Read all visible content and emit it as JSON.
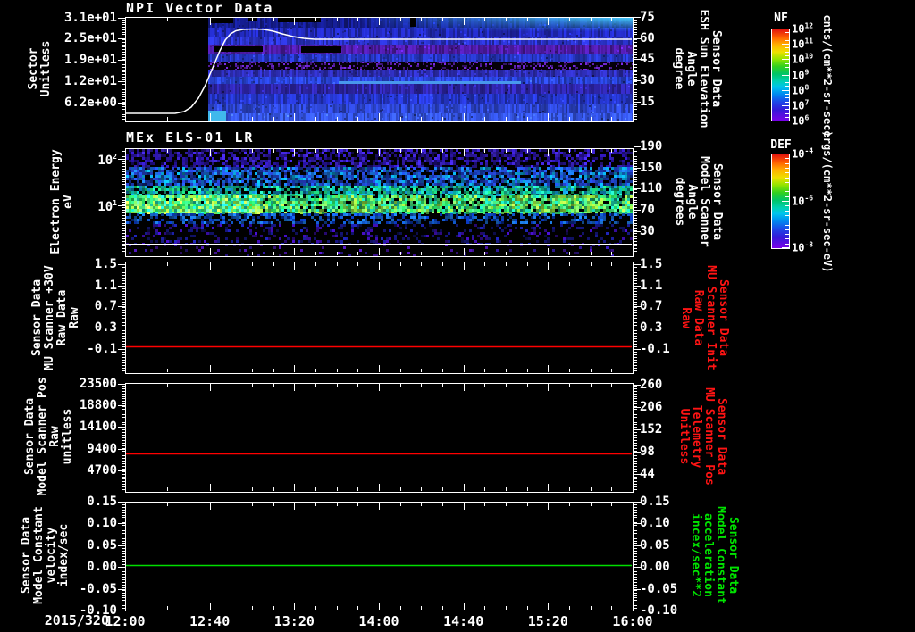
{
  "page": {
    "background": "#000000",
    "foreground": "#ffffff"
  },
  "x_axis": {
    "date_label": "2015/320",
    "tick_labels": [
      "12:00",
      "12:40",
      "13:20",
      "14:00",
      "14:40",
      "15:20",
      "16:00"
    ]
  },
  "panels": [
    {
      "id": "npi",
      "title": "NPI Vector Data",
      "left_label_lines": [
        "Sector",
        "Unitless"
      ],
      "left_ticks": [
        "3.1e+01",
        "2.5e+01",
        "1.9e+01",
        "1.2e+01",
        "6.2e+00"
      ],
      "right_label_lines": [
        "Sensor Data",
        "ESH Sun Elevation",
        "Angle",
        "degree"
      ],
      "right_ticks": [
        "75",
        "60",
        "45",
        "30",
        "15"
      ],
      "right_label_color": "#ffffff"
    },
    {
      "id": "els",
      "title": "MEx ELS-01 LR",
      "left_label_lines": [
        "Electron Energy",
        "eV"
      ],
      "left_ticks": [
        "10^2",
        "10^1"
      ],
      "right_label_lines": [
        "Sensor Data",
        "Model Scanner",
        "Angle",
        "degrees"
      ],
      "right_ticks": [
        "190",
        "150",
        "110",
        "70",
        "30"
      ],
      "right_label_color": "#ffffff"
    },
    {
      "id": "mu-scanner-30v",
      "title": "",
      "left_label_lines": [
        "Sensor Data",
        "MU Scanner +30V",
        "Raw Data",
        "Raw"
      ],
      "left_ticks": [
        "1.5",
        "1.1",
        "0.7",
        "0.3",
        "-0.1"
      ],
      "right_label_lines": [
        "Sensor Data",
        "MU Scanner Init",
        "Raw Data",
        "Raw"
      ],
      "right_ticks": [
        "1.5",
        "1.1",
        "0.7",
        "0.3",
        "-0.1"
      ],
      "right_label_color": "#ff1414",
      "line": {
        "color": "#ff0000",
        "value": 0.0
      }
    },
    {
      "id": "model-scanner-pos",
      "title": "",
      "left_label_lines": [
        "Sensor Data",
        "Model Scanner Pos",
        "Raw",
        "unitless"
      ],
      "left_ticks": [
        "23500",
        "18800",
        "14100",
        "9400",
        "4700"
      ],
      "right_label_lines": [
        "Sensor Data",
        "MU Scanner Pos",
        "Telemetry",
        "Unitless"
      ],
      "right_ticks": [
        "260",
        "206",
        "152",
        "98",
        "44"
      ],
      "right_label_color": "#ff1414",
      "line": {
        "color": "#ff0000",
        "value": 8100
      }
    },
    {
      "id": "model-constant-velocity",
      "title": "",
      "left_label_lines": [
        "Sensor Data",
        "Model Constant",
        "velocity",
        "index/sec"
      ],
      "left_ticks": [
        "0.15",
        "0.10",
        "0.05",
        "0.00",
        "-0.05",
        "-0.10"
      ],
      "right_label_lines": [
        "Sensor Data",
        "Model Constant",
        "acceleration",
        "incex/sec**2"
      ],
      "right_ticks": [
        "0.15",
        "0.10",
        "0.05",
        "0.00",
        "-0.05",
        "-0.10"
      ],
      "right_label_color": "#00e400",
      "line": {
        "color": "#00dd00",
        "value": 0.0
      }
    }
  ],
  "colorbars": [
    {
      "title": "NF",
      "tick_labels": [
        "10^12",
        "10^11",
        "10^10",
        "10^9",
        "10^8",
        "10^7",
        "10^6"
      ],
      "units": "cnts/(cm**2-sr-sec)"
    },
    {
      "title": "DEF",
      "tick_labels": [
        "10^-4",
        "10^-6",
        "10^-8"
      ],
      "units": "ergs/(cm**2-sr-sec-eV)"
    }
  ],
  "chart_data": [
    {
      "type": "heatmap",
      "id": "npi",
      "title": "NPI Vector Data",
      "x_range": [
        "12:00",
        "16:00"
      ],
      "data_gap_until": "12:39",
      "ylabel": "Sector Unitless",
      "y_ticks": [
        31,
        25,
        19,
        12,
        6.2
      ],
      "z_units": "cnts/(cm**2-sr-sec)",
      "z_range_log10": [
        6,
        12
      ],
      "bands": [
        {
          "y0": 0.0,
          "y1": 0.095,
          "color": "#141c8c",
          "var": 0.5
        },
        {
          "y0": 0.095,
          "y1": 0.19,
          "color": "#2028b4",
          "var": 0.4
        },
        {
          "y0": 0.19,
          "y1": 0.26,
          "color": "#2830c0",
          "var": 0.4
        },
        {
          "y0": 0.26,
          "y1": 0.345,
          "color": "#4a1aa0",
          "var": 0.5
        },
        {
          "y0": 0.345,
          "y1": 0.42,
          "color": "#2534bc",
          "var": 0.4
        },
        {
          "y0": 0.42,
          "y1": 0.5,
          "color": "#050008",
          "var": 0.3,
          "speckle": {
            "color": "#5a1ea8",
            "density": 0.3
          }
        },
        {
          "y0": 0.5,
          "y1": 0.565,
          "color": "#2c2cb0",
          "var": 0.5
        },
        {
          "y0": 0.565,
          "y1": 0.64,
          "color": "#2842d4",
          "var": 0.45
        },
        {
          "y0": 0.64,
          "y1": 0.73,
          "color": "#2c24a4",
          "var": 0.45
        },
        {
          "y0": 0.73,
          "y1": 0.83,
          "color": "#2434c4",
          "var": 0.4
        },
        {
          "y0": 0.83,
          "y1": 0.92,
          "color": "#2c44cc",
          "var": 0.4
        },
        {
          "y0": 0.92,
          "y1": 1.0,
          "color": "#3352e0",
          "var": 0.45
        }
      ],
      "features": {
        "start_frac": 0.162,
        "cyan_glow": {
          "color": "#46cdff",
          "x_frac": 0.45,
          "depth_frac": 0.13
        },
        "black_blobs": [
          [
            0.165,
            0.0,
            0.045,
            0.05
          ],
          [
            0.24,
            0.0,
            0.02,
            0.035
          ],
          [
            0.3,
            0.0,
            0.085,
            0.04
          ],
          [
            0.175,
            0.27,
            0.095,
            0.06
          ],
          [
            0.345,
            0.265,
            0.08,
            0.07
          ],
          [
            0.56,
            0.0,
            0.012,
            0.09
          ]
        ],
        "cyan_patch": [
          0.162,
          0.9,
          0.035,
          0.1
        ],
        "streak": {
          "y": 0.615,
          "x0": 0.42,
          "x1": 0.78,
          "color": "#4898ec"
        }
      },
      "overlay_line": {
        "name": "Sensor Data ESH Sun Elevation Angle",
        "units": "degree",
        "color": "#ffffff",
        "points_time_deg": [
          [
            "12:00",
            7.5
          ],
          [
            "12:24",
            7.5
          ],
          [
            "12:40",
            48
          ],
          [
            "12:48",
            64
          ],
          [
            "12:56",
            66
          ],
          [
            "13:05",
            65
          ],
          [
            "13:20",
            61
          ],
          [
            "13:30",
            60
          ],
          [
            "16:00",
            60
          ]
        ]
      }
    },
    {
      "type": "heatmap",
      "id": "els",
      "title": "MEx ELS-01 LR",
      "x_range": [
        "12:00",
        "16:00"
      ],
      "ylabel": "Electron Energy eV",
      "y_scale": "log",
      "y_ticks": [
        100,
        10
      ],
      "z_units": "ergs/(cm**2-sr-sec-eV)",
      "z_range_log10": [
        -8,
        -4
      ],
      "peak_band_energy_eV": [
        8,
        25
      ],
      "bands": [
        {
          "y0": 0.0,
          "y1": 0.17,
          "palette": [
            "#2a14a0",
            "#1c0c78",
            "#3820b8",
            "#000000"
          ],
          "density": 0.75
        },
        {
          "y0": 0.17,
          "y1": 0.34,
          "palette": [
            "#1c48cc",
            "#1870d8",
            "#0898c8",
            "#102880",
            "#2038b0"
          ],
          "density": 0.8
        },
        {
          "y0": 0.34,
          "y1": 0.43,
          "palette": [
            "#08a89c",
            "#18b86c",
            "#1088c0",
            "#20c8a0"
          ],
          "density": 0.8
        },
        {
          "y0": 0.43,
          "y1": 0.6,
          "palette": [
            "#28d860",
            "#48e87c",
            "#18c0a0",
            "#70e858",
            "#98e840"
          ],
          "density": 0.9,
          "left_boost": true
        },
        {
          "y0": 0.6,
          "y1": 0.7,
          "palette": [
            "#1050b8",
            "#0830a0",
            "#1868c0",
            "#000000"
          ],
          "density": 0.7
        },
        {
          "y0": 0.7,
          "y1": 0.885,
          "palette": [
            "#181c90",
            "#380ca0",
            "#101060",
            "#000000",
            "#000000"
          ],
          "density": 0.45
        },
        {
          "y0": 0.885,
          "y1": 1.0,
          "palette": [
            "#43129c",
            "#2a1490",
            "#000000"
          ],
          "density": 0.12
        }
      ],
      "white_marker_line_frac": 0.885
    },
    {
      "type": "line",
      "name": "Sensor Data MU Scanner +30V Raw Data Raw",
      "color": "#ff0000",
      "x_range": [
        "12:00",
        "16:00"
      ],
      "constant_value": 0.0,
      "y_ticks": [
        1.5,
        1.1,
        0.7,
        0.3,
        -0.1
      ]
    },
    {
      "type": "line",
      "name": "Sensor Data Model Scanner Pos Raw unitless",
      "color": "#ff0000",
      "x_range": [
        "12:00",
        "16:00"
      ],
      "constant_value": 8100,
      "y_ticks": [
        23500,
        18800,
        14100,
        9400,
        4700
      ],
      "right_axis": {
        "name": "MU Scanner Pos Telemetry",
        "ticks": [
          260,
          206,
          152,
          98,
          44
        ]
      }
    },
    {
      "type": "line",
      "name": "Sensor Data Model Constant velocity index/sec",
      "color": "#00dd00",
      "x_range": [
        "12:00",
        "16:00"
      ],
      "constant_value": 0.0,
      "y_ticks": [
        0.15,
        0.1,
        0.05,
        0.0,
        -0.05,
        -0.1
      ]
    }
  ]
}
